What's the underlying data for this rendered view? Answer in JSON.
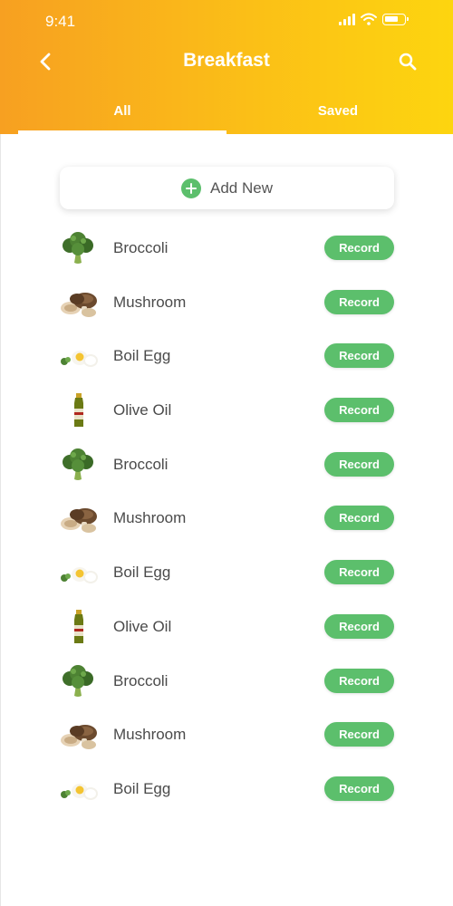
{
  "status": {
    "time": "9:41"
  },
  "header": {
    "title": "Breakfast",
    "back_icon": "chevron-left-icon",
    "search_icon": "search-icon"
  },
  "tabs": [
    {
      "label": "All",
      "active": true
    },
    {
      "label": "Saved",
      "active": false
    }
  ],
  "add_new": {
    "label": "Add New",
    "icon": "plus-circle-icon"
  },
  "colors": {
    "header_start": "#f7a021",
    "header_end": "#fdd50f",
    "accent_green": "#5cbf6c"
  },
  "foods": [
    {
      "name": "Broccoli",
      "icon": "broccoli",
      "button": "Record"
    },
    {
      "name": "Mushroom",
      "icon": "mushroom",
      "button": "Record"
    },
    {
      "name": "Boil Egg",
      "icon": "egg",
      "button": "Record"
    },
    {
      "name": "Olive Oil",
      "icon": "olive-oil",
      "button": "Record"
    },
    {
      "name": "Broccoli",
      "icon": "broccoli",
      "button": "Record"
    },
    {
      "name": "Mushroom",
      "icon": "mushroom",
      "button": "Record"
    },
    {
      "name": "Boil Egg",
      "icon": "egg",
      "button": "Record"
    },
    {
      "name": "Olive Oil",
      "icon": "olive-oil",
      "button": "Record"
    },
    {
      "name": "Broccoli",
      "icon": "broccoli",
      "button": "Record"
    },
    {
      "name": "Mushroom",
      "icon": "mushroom",
      "button": "Record"
    },
    {
      "name": "Boil Egg",
      "icon": "egg",
      "button": "Record"
    }
  ]
}
